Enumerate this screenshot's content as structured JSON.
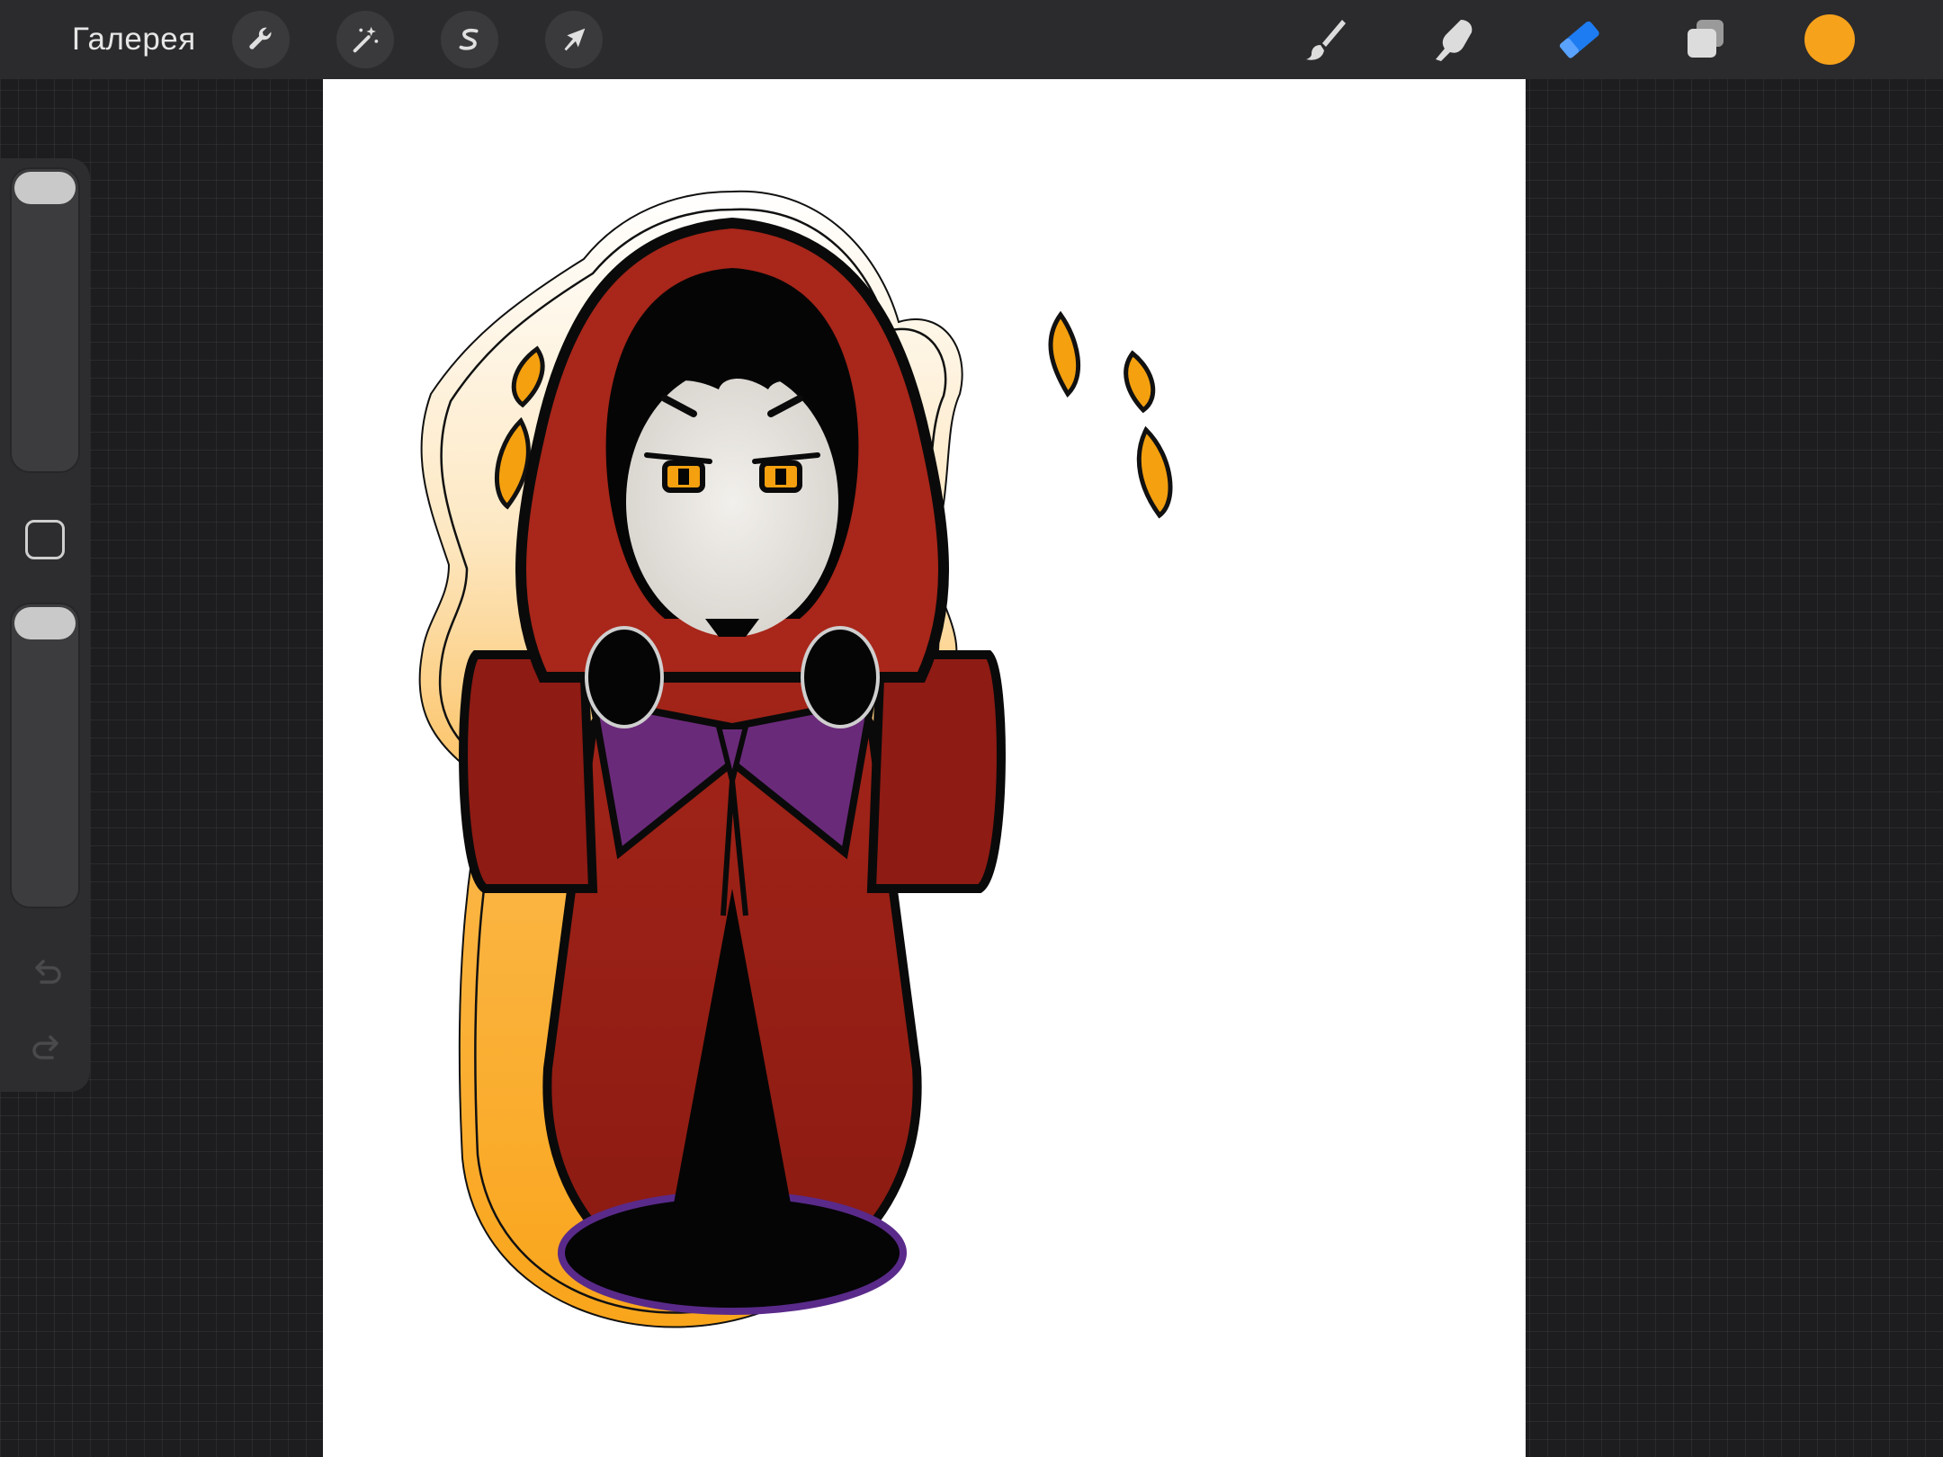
{
  "topbar": {
    "gallery_label": "Галерея",
    "tools_left": [
      {
        "name": "actions",
        "icon": "wrench-icon"
      },
      {
        "name": "adjustments",
        "icon": "magic-wand-icon"
      },
      {
        "name": "selection",
        "icon": "selection-s-icon"
      },
      {
        "name": "transform",
        "icon": "arrow-cursor-icon"
      }
    ],
    "tools_right": [
      {
        "name": "brush",
        "icon": "brush-icon",
        "active": false
      },
      {
        "name": "smudge",
        "icon": "smudge-finger-icon",
        "active": false
      },
      {
        "name": "eraser",
        "icon": "eraser-icon",
        "active": true
      },
      {
        "name": "layers",
        "icon": "layers-icon",
        "active": false
      }
    ],
    "current_color": "#F7A21B"
  },
  "sidebar": {
    "brush_size_level": 0.0,
    "opacity_level": 0.0,
    "modify_button_icon": "square-outline-icon",
    "undo_icon": "undo-arrow-icon",
    "redo_icon": "redo-arrow-icon"
  },
  "canvas": {
    "background": "#FFFFFF",
    "artwork": "hooded-figure-sticker",
    "colors": {
      "robe_red": "#8E1B14",
      "robe_red_light": "#B0291B",
      "outline": "#0A0A0A",
      "glow_orange": "#F9A51B",
      "eye_orange": "#F4A00F",
      "face": "#E8E6E2",
      "purple": "#6A2A7A"
    }
  },
  "accent": {
    "active_tool": "#1E7CF2",
    "icon_light": "#DCDCDC"
  }
}
